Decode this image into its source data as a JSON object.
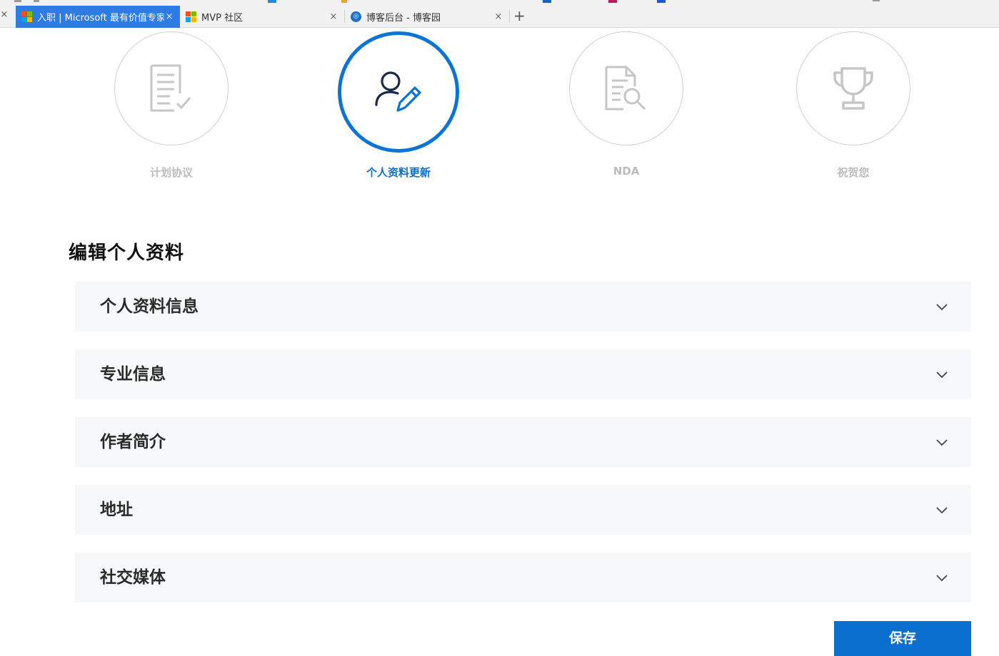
{
  "browser": {
    "tabs": [
      {
        "title": "入职 | Microsoft 最有价值专家",
        "close": "×",
        "active": true,
        "favicon": "microsoft-logo"
      },
      {
        "title": "MVP 社区",
        "close": "×",
        "active": false,
        "favicon": "microsoft-logo"
      },
      {
        "title": "博客后台 - 博客园",
        "close": "×",
        "active": false,
        "favicon": "cnblogs-logo"
      }
    ],
    "lead_close": "×",
    "new_tab": "+"
  },
  "steps": [
    {
      "label": "计划协议",
      "icon": "document-check-icon",
      "state": "inactive"
    },
    {
      "label": "个人资料更新",
      "icon": "user-edit-icon",
      "state": "current"
    },
    {
      "label": "NDA",
      "icon": "document-search-icon",
      "state": "inactive"
    },
    {
      "label": "祝贺您",
      "icon": "trophy-icon",
      "state": "inactive"
    }
  ],
  "page": {
    "heading": "编辑个人资料",
    "sections": [
      {
        "title": "个人资料信息",
        "icon": "chevron-down-icon"
      },
      {
        "title": "专业信息",
        "icon": "chevron-down-icon"
      },
      {
        "title": "作者简介",
        "icon": "chevron-down-icon"
      },
      {
        "title": "地址",
        "icon": "chevron-down-icon"
      },
      {
        "title": "社交媒体",
        "icon": "chevron-down-icon"
      }
    ],
    "save_label": "保存"
  },
  "colors": {
    "accent": "#0b74d6",
    "tab_active": "#2d7be5",
    "inactive_step": "#bcbcbc",
    "section_bg": "#f7f8f9"
  }
}
